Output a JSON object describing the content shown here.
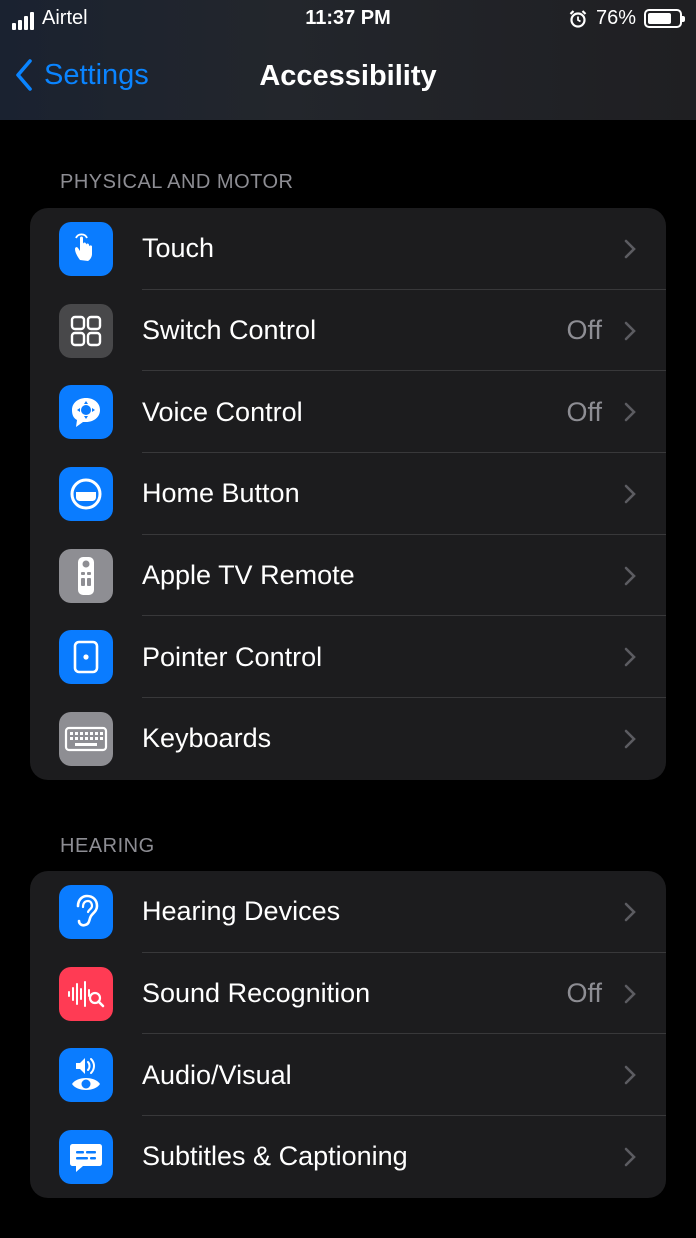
{
  "status_bar": {
    "carrier": "Airtel",
    "time": "11:37 PM",
    "battery_percent": "76%",
    "battery_level": 0.76
  },
  "nav": {
    "back_label": "Settings",
    "title": "Accessibility"
  },
  "sections": [
    {
      "header": "PHYSICAL AND MOTOR",
      "items": [
        {
          "label": "Touch",
          "value": "",
          "icon": "hand-touch-icon",
          "color": "#0a7cff"
        },
        {
          "label": "Switch Control",
          "value": "Off",
          "icon": "switch-control-icon",
          "color": "#48484a"
        },
        {
          "label": "Voice Control",
          "value": "Off",
          "icon": "voice-control-icon",
          "color": "#0a7cff"
        },
        {
          "label": "Home Button",
          "value": "",
          "icon": "home-button-icon",
          "color": "#0a7cff"
        },
        {
          "label": "Apple TV Remote",
          "value": "",
          "icon": "tv-remote-icon",
          "color": "#8e8e93"
        },
        {
          "label": "Pointer Control",
          "value": "",
          "icon": "pointer-control-icon",
          "color": "#0a7cff"
        },
        {
          "label": "Keyboards",
          "value": "",
          "icon": "keyboard-icon",
          "color": "#8e8e93"
        }
      ]
    },
    {
      "header": "HEARING",
      "items": [
        {
          "label": "Hearing Devices",
          "value": "",
          "icon": "ear-icon",
          "color": "#0a7cff"
        },
        {
          "label": "Sound Recognition",
          "value": "Off",
          "icon": "sound-recognition-icon",
          "color": "#ff3b54"
        },
        {
          "label": "Audio/Visual",
          "value": "",
          "icon": "audio-visual-icon",
          "color": "#0a7cff"
        },
        {
          "label": "Subtitles & Captioning",
          "value": "",
          "icon": "subtitles-icon",
          "color": "#0a7cff"
        }
      ]
    }
  ]
}
